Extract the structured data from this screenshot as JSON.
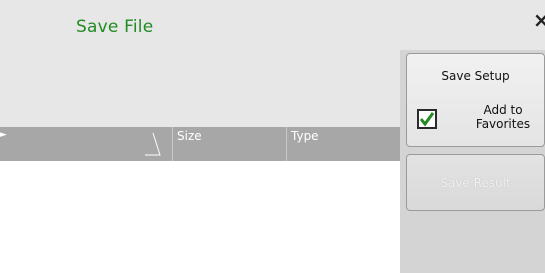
{
  "dialog": {
    "title": "Save File",
    "close_glyph": "×"
  },
  "file_list": {
    "columns": [
      "Size",
      "Type"
    ]
  },
  "side_panel": {
    "save_setup_label": "Save Setup",
    "add_to_favorites": {
      "line1": "Add to",
      "line2": "Favorites",
      "checked": true
    },
    "save_result_label": "Save Result"
  },
  "colors": {
    "title": "#228b22",
    "checkmark": "#228b22",
    "header_bg": "#a7a7a7"
  },
  "icons": [
    "close-icon",
    "checkmark-icon",
    "sort-indicator-icon"
  ]
}
